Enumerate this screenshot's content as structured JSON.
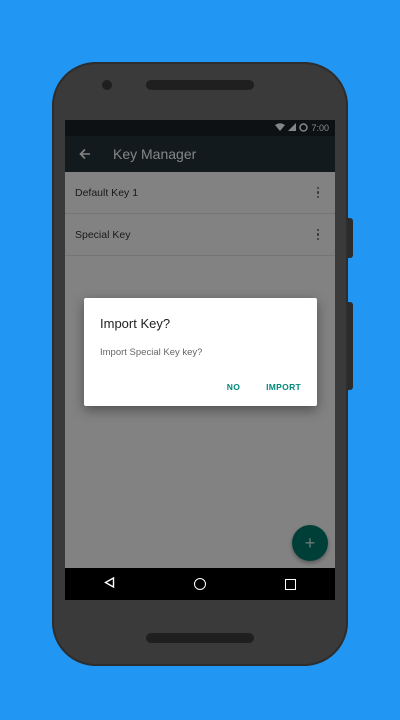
{
  "status_bar": {
    "time": "7:00"
  },
  "toolbar": {
    "title": "Key Manager",
    "back_icon": "arrow-left-icon"
  },
  "keys": [
    {
      "name": "Default Key 1"
    },
    {
      "name": "Special Key"
    }
  ],
  "fab": {
    "icon": "plus-icon",
    "glyph": "+"
  },
  "dialog": {
    "title": "Import Key?",
    "message": "Import Special Key key?",
    "negative_label": "NO",
    "positive_label": "IMPORT"
  },
  "colors": {
    "background": "#2196f3",
    "toolbar": "#263238",
    "accent": "#00897b"
  }
}
